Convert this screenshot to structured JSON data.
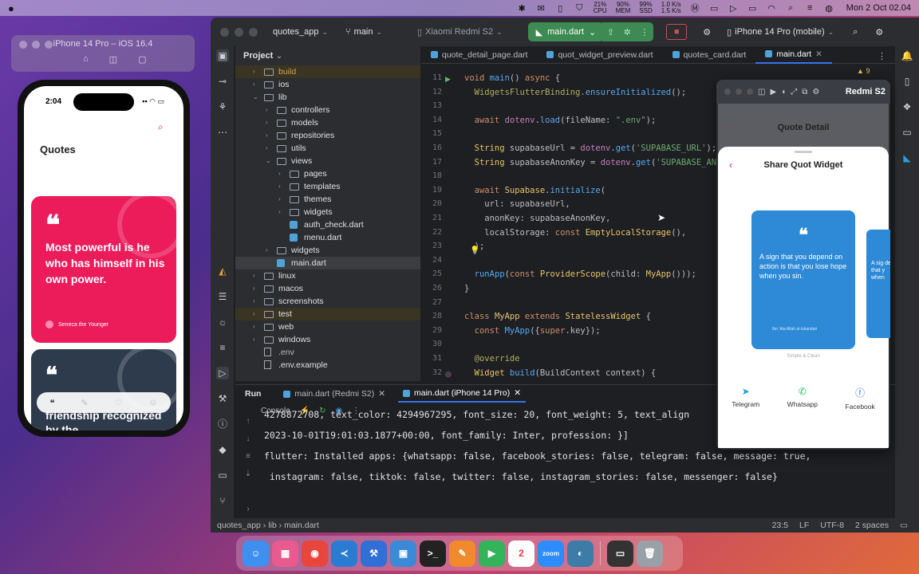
{
  "menubar": {
    "apple": "",
    "stats": [
      {
        "line1": "21%",
        "line2": "CPU"
      },
      {
        "line1": "90%",
        "line2": "MEM"
      },
      {
        "line1": "99%",
        "line2": "SSD"
      },
      {
        "line1": "1.0 K/s",
        "line2": "1.5 K/s"
      }
    ],
    "clock": "Mon 2 Oct  02.04"
  },
  "simulator": {
    "title": "iPhone 14 Pro – iOS 16.4",
    "phone": {
      "time": "2:04",
      "page_title": "Quotes",
      "cards": [
        {
          "mark": "❝",
          "text": "Most powerful is he who has himself in his own power.",
          "author": "Seneca the Younger"
        },
        {
          "mark": "❝",
          "text": "friendship recognized by the"
        }
      ]
    }
  },
  "ide": {
    "project": "quotes_app",
    "branch": "main",
    "device_left": "Xiaomi Redmi S2",
    "run_config": "main.dart",
    "device_right": "iPhone 14 Pro (mobile)",
    "panel_title": "Project",
    "tree": [
      {
        "label": "build",
        "indent": 0,
        "kind": "folder",
        "arrow": "›",
        "style": "orange",
        "row": "hl"
      },
      {
        "label": "ios",
        "indent": 0,
        "kind": "folder",
        "arrow": "›"
      },
      {
        "label": "lib",
        "indent": 0,
        "kind": "folder",
        "arrow": "⌄"
      },
      {
        "label": "controllers",
        "indent": 1,
        "kind": "folder",
        "arrow": "›"
      },
      {
        "label": "models",
        "indent": 1,
        "kind": "folder",
        "arrow": "›"
      },
      {
        "label": "repositories",
        "indent": 1,
        "kind": "folder",
        "arrow": "›"
      },
      {
        "label": "utils",
        "indent": 1,
        "kind": "folder",
        "arrow": "›"
      },
      {
        "label": "views",
        "indent": 1,
        "kind": "folder",
        "arrow": "⌄"
      },
      {
        "label": "pages",
        "indent": 2,
        "kind": "folder",
        "arrow": "›"
      },
      {
        "label": "templates",
        "indent": 2,
        "kind": "folder",
        "arrow": "›"
      },
      {
        "label": "themes",
        "indent": 2,
        "kind": "folder",
        "arrow": "›"
      },
      {
        "label": "widgets",
        "indent": 2,
        "kind": "folder",
        "arrow": "›"
      },
      {
        "label": "auth_check.dart",
        "indent": 2,
        "kind": "dart",
        "arrow": ""
      },
      {
        "label": "menu.dart",
        "indent": 2,
        "kind": "dart",
        "arrow": ""
      },
      {
        "label": "widgets",
        "indent": 1,
        "kind": "folder",
        "arrow": "›"
      },
      {
        "label": "main.dart",
        "indent": 1,
        "kind": "dart",
        "arrow": "",
        "row": "sel"
      },
      {
        "label": "linux",
        "indent": 0,
        "kind": "folder",
        "arrow": "›"
      },
      {
        "label": "macos",
        "indent": 0,
        "kind": "folder",
        "arrow": "›"
      },
      {
        "label": "screenshots",
        "indent": 0,
        "kind": "folder",
        "arrow": "›"
      },
      {
        "label": "test",
        "indent": 0,
        "kind": "folder",
        "arrow": "›",
        "row": "hl"
      },
      {
        "label": "web",
        "indent": 0,
        "kind": "folder",
        "arrow": "›"
      },
      {
        "label": "windows",
        "indent": 0,
        "kind": "folder",
        "arrow": "›"
      },
      {
        "label": ".env",
        "indent": 0,
        "kind": "text",
        "arrow": "",
        "style": "dim"
      },
      {
        "label": ".env.example",
        "indent": 0,
        "kind": "text",
        "arrow": ""
      }
    ],
    "tabs": [
      "quote_detail_page.dart",
      "quot_widget_preview.dart",
      "quotes_card.dart",
      "main.dart"
    ],
    "active_tab_index": 3,
    "inspection_count": "9",
    "line_numbers": [
      "11",
      "12",
      "13",
      "14",
      "15",
      "16",
      "17",
      "18",
      "19",
      "20",
      "21",
      "22",
      "23",
      "24",
      "25",
      "26",
      "27",
      "28",
      "29",
      "30",
      "31",
      "32"
    ],
    "code_lines": [
      [
        {
          "t": "void ",
          "c": "kw"
        },
        {
          "t": "main",
          "c": "fn"
        },
        {
          "t": "() ",
          "c": "pm"
        },
        {
          "t": "async ",
          "c": "kw"
        },
        {
          "t": "{",
          "c": "pm"
        }
      ],
      [
        {
          "t": "  WidgetsFlutterBinding.",
          "c": "an"
        },
        {
          "t": "ensureInitialized",
          "c": "fn"
        },
        {
          "t": "();",
          "c": "pm"
        }
      ],
      [],
      [
        {
          "t": "  await ",
          "c": "kw"
        },
        {
          "t": "dotenv",
          "c": "ty"
        },
        {
          "t": ".",
          "c": "pm"
        },
        {
          "t": "load",
          "c": "fn"
        },
        {
          "t": "(fileName: ",
          "c": "pm"
        },
        {
          "t": "\".env\"",
          "c": "st"
        },
        {
          "t": ");",
          "c": "pm"
        }
      ],
      [],
      [
        {
          "t": "  String ",
          "c": "cls"
        },
        {
          "t": "supabaseUrl = ",
          "c": "pm"
        },
        {
          "t": "dotenv",
          "c": "ty"
        },
        {
          "t": ".",
          "c": "pm"
        },
        {
          "t": "get",
          "c": "fn"
        },
        {
          "t": "(",
          "c": "pm"
        },
        {
          "t": "'SUPABASE_URL'",
          "c": "st"
        },
        {
          "t": ");",
          "c": "pm"
        }
      ],
      [
        {
          "t": "  String ",
          "c": "cls"
        },
        {
          "t": "supabaseAnonKey = ",
          "c": "pm"
        },
        {
          "t": "dotenv",
          "c": "ty"
        },
        {
          "t": ".",
          "c": "pm"
        },
        {
          "t": "get",
          "c": "fn"
        },
        {
          "t": "(",
          "c": "pm"
        },
        {
          "t": "'SUPABASE_AN",
          "c": "st"
        }
      ],
      [],
      [
        {
          "t": "  await ",
          "c": "kw"
        },
        {
          "t": "Supabase",
          "c": "cls"
        },
        {
          "t": ".",
          "c": "pm"
        },
        {
          "t": "initialize",
          "c": "fn"
        },
        {
          "t": "(",
          "c": "pm"
        }
      ],
      [
        {
          "t": "    url: supabaseUrl,",
          "c": "pm"
        }
      ],
      [
        {
          "t": "    anonKey: supabaseAnonKey,",
          "c": "pm"
        }
      ],
      [
        {
          "t": "    localStorage: ",
          "c": "pm"
        },
        {
          "t": "const ",
          "c": "kw"
        },
        {
          "t": "EmptyLocalStorage",
          "c": "cls"
        },
        {
          "t": "(),",
          "c": "pm"
        }
      ],
      [
        {
          "t": "  );",
          "c": "pm"
        }
      ],
      [],
      [
        {
          "t": "  ",
          "c": "pm"
        },
        {
          "t": "runApp",
          "c": "fn"
        },
        {
          "t": "(",
          "c": "pm"
        },
        {
          "t": "const ",
          "c": "kw"
        },
        {
          "t": "ProviderScope",
          "c": "cls"
        },
        {
          "t": "(child: ",
          "c": "pm"
        },
        {
          "t": "MyApp",
          "c": "cls"
        },
        {
          "t": "()));",
          "c": "pm"
        }
      ],
      [
        {
          "t": "}",
          "c": "pm"
        }
      ],
      [],
      [
        {
          "t": "class ",
          "c": "kw"
        },
        {
          "t": "MyApp ",
          "c": "cls"
        },
        {
          "t": "extends ",
          "c": "kw"
        },
        {
          "t": "StatelessWidget ",
          "c": "cls"
        },
        {
          "t": "{",
          "c": "pm"
        }
      ],
      [
        {
          "t": "  const ",
          "c": "kw"
        },
        {
          "t": "MyApp",
          "c": "fn"
        },
        {
          "t": "({",
          "c": "pm"
        },
        {
          "t": "super",
          "c": "kw"
        },
        {
          "t": ".key});",
          "c": "pm"
        }
      ],
      [],
      [
        {
          "t": "  @override",
          "c": "an"
        }
      ],
      [
        {
          "t": "  Widget ",
          "c": "cls"
        },
        {
          "t": "build",
          "c": "fn"
        },
        {
          "t": "(BuildContext context) {",
          "c": "pm"
        }
      ]
    ],
    "run": {
      "title": "Run",
      "tabs": [
        "main.dart (Redmi S2)",
        "main.dart (iPhone 14 Pro)"
      ],
      "console_label": "Console",
      "output": [
        "4278872708, text_color: 4294967295, font_size: 20, font_weight: 5, text_align",
        "2023-10-01T19:01:03.1877+00:00, font_family: Inter, profession: }]",
        "flutter: Installed apps: {whatsapp: false, facebook_stories: false, telegram: false, message: true,",
        " instagram: false, tiktok: false, twitter: false, instagram_stories: false, messenger: false}"
      ]
    },
    "status": {
      "breadcrumb": [
        "quotes_app",
        "lib",
        "main.dart"
      ],
      "position": "23:5",
      "line_sep": "LF",
      "encoding": "UTF-8",
      "indent": "2 spaces"
    }
  },
  "emulator": {
    "device": "Redmi S2",
    "header_title": "Quote Detail",
    "sheet_title": "Share Quot Widget",
    "widget": {
      "mark": "❝",
      "text": "A sign that you depend on action is that you lose hope when you sin.",
      "author": "Ibn 'Ata Allah al-Iskandari",
      "caption": "Simple & Clean",
      "peek_text": "A sig depe that y when"
    },
    "share": [
      {
        "label": "Telegram",
        "icon": "telegram-icon"
      },
      {
        "label": "Whatsapp",
        "icon": "whatsapp-icon"
      },
      {
        "label": "Facebook",
        "icon": "facebook-icon"
      }
    ]
  },
  "dock": {
    "apps": [
      {
        "name": "finder",
        "color": "#3e8ff0",
        "glyph": "☺"
      },
      {
        "name": "launchpad",
        "color": "#e95b8f",
        "glyph": "▦"
      },
      {
        "name": "chrome",
        "color": "#e8453c",
        "glyph": "◉"
      },
      {
        "name": "vscode",
        "color": "#2a7cd3",
        "glyph": "≺"
      },
      {
        "name": "xcode",
        "color": "#2f6fd6",
        "glyph": "⚒"
      },
      {
        "name": "simulator",
        "color": "#3a8ad8",
        "glyph": "▣"
      },
      {
        "name": "terminal",
        "color": "#222222",
        "glyph": ">_"
      },
      {
        "name": "pencil",
        "color": "#f08a2c",
        "glyph": "✎"
      },
      {
        "name": "facetime",
        "color": "#33b45a",
        "glyph": "▶"
      },
      {
        "name": "calendar",
        "color": "#ffffff",
        "glyph": "2"
      },
      {
        "name": "zoom",
        "color": "#2d8cff",
        "glyph": "zoom"
      },
      {
        "name": "android-studio",
        "color": "#3d7ca8",
        "glyph": "◐"
      },
      {
        "name": "screen-record",
        "color": "#333333",
        "glyph": "▭"
      },
      {
        "name": "trash",
        "color": "#9aa0a8",
        "glyph": "🗑"
      }
    ]
  }
}
